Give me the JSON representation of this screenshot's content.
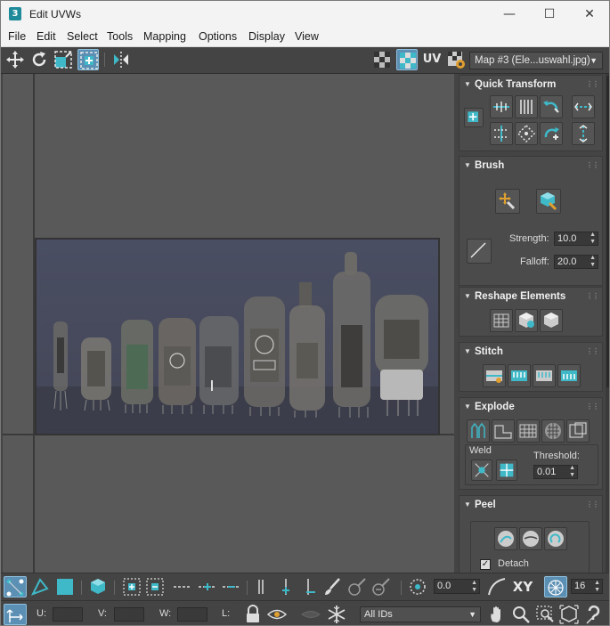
{
  "window": {
    "title": "Edit UVWs",
    "app_icon": "3",
    "controls": {
      "minimize": "—",
      "maximize": "☐",
      "close": "✕"
    }
  },
  "menu": [
    "File",
    "Edit",
    "Select",
    "Tools",
    "Mapping",
    "Options",
    "Display",
    "View"
  ],
  "toolbar": {
    "uv_label": "UV",
    "map_dropdown": "Map #3 (Ele...uswahl.jpg)"
  },
  "panel": {
    "quick_transform": {
      "title": "Quick Transform"
    },
    "brush": {
      "title": "Brush",
      "strength_label": "Strength:",
      "strength_value": "10.0",
      "falloff_label": "Falloff:",
      "falloff_value": "20.0"
    },
    "reshape": {
      "title": "Reshape Elements"
    },
    "stitch": {
      "title": "Stitch"
    },
    "explode": {
      "title": "Explode",
      "weld_label": "Weld",
      "threshold_label": "Threshold:",
      "threshold_value": "0.01"
    },
    "peel": {
      "title": "Peel",
      "detach_label": "Detach"
    }
  },
  "bottom": {
    "rotation_value": "0.0",
    "xy_label": "XY",
    "grid_value": "16",
    "u_label": "U:",
    "v_label": "V:",
    "w_label": "W:",
    "l_label": "L:",
    "ids_dropdown": "All IDs"
  },
  "colors": {
    "accent_cyan": "#3fb8c8",
    "selected_blue": "#5b8fb3",
    "panel_bg": "#444444"
  }
}
